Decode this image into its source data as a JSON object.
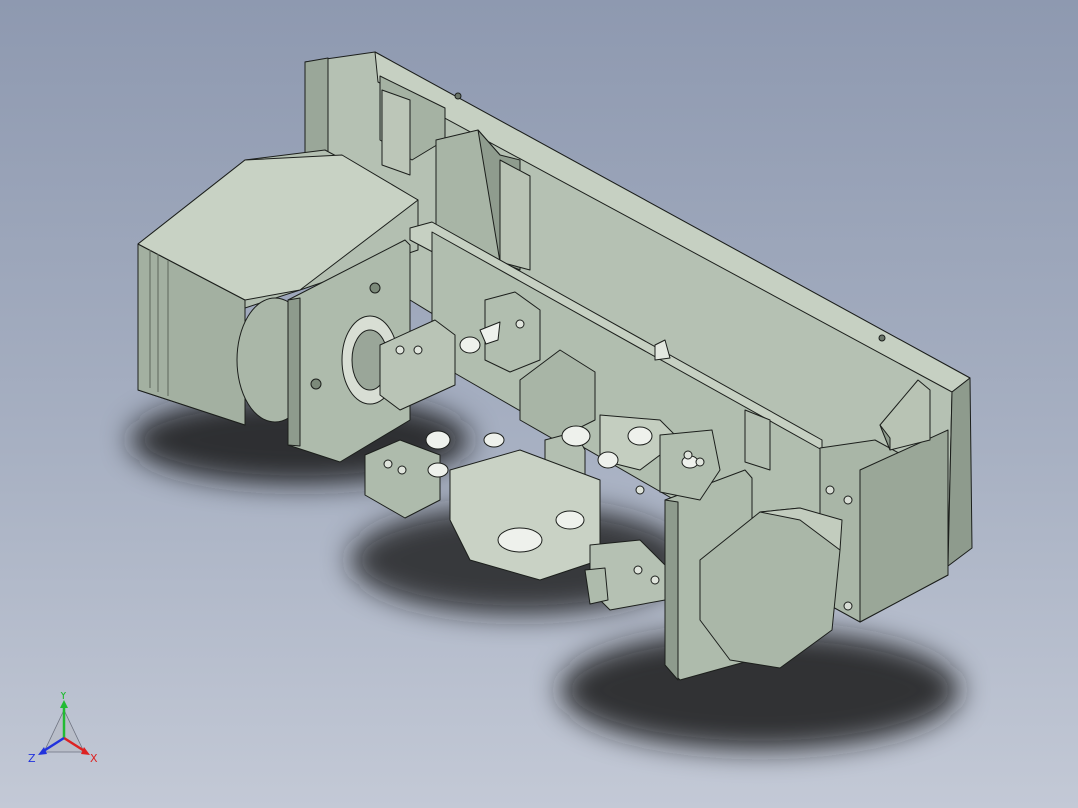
{
  "viewport": {
    "background_top": "#8e99b0",
    "background_bottom": "#c3c9d6",
    "model_color": "#a9b6a8",
    "model_dark": "#8f9c8e",
    "model_light": "#c3cdbf"
  },
  "triad": {
    "y_label": "Y",
    "x_label": "X",
    "z_label": "Z",
    "y_color": "#22bb33",
    "x_color": "#dd2222",
    "z_color": "#2233dd"
  }
}
